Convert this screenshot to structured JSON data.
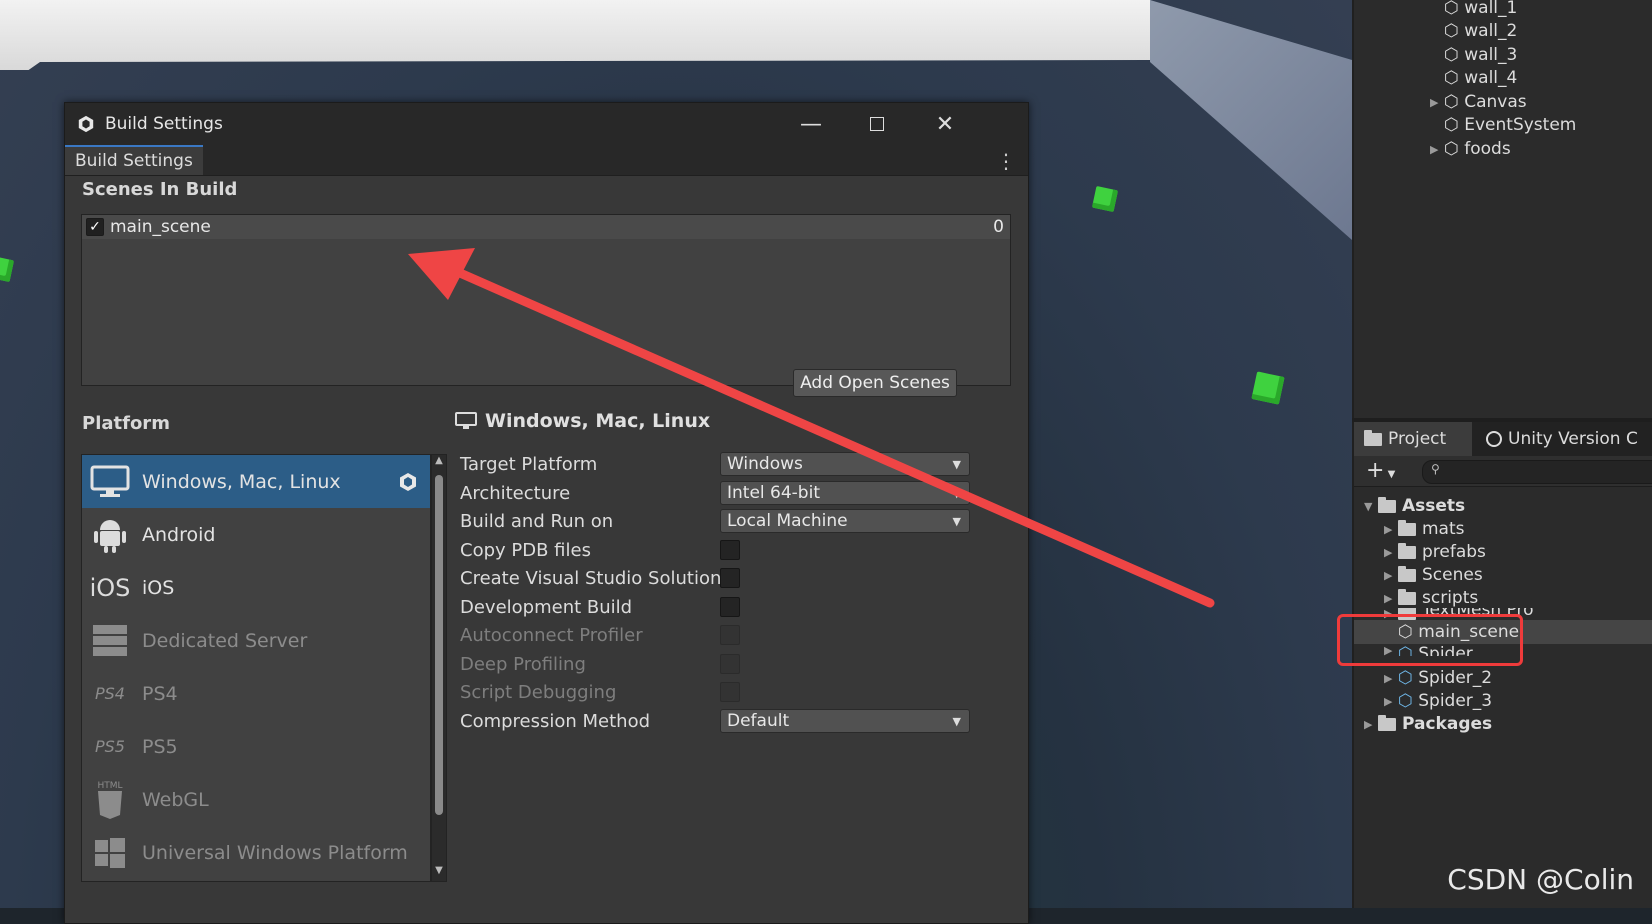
{
  "window": {
    "title": "Build Settings",
    "tab_label": "Build Settings"
  },
  "scenes": {
    "heading": "Scenes In Build",
    "items": [
      {
        "name": "main_scene",
        "index": "0",
        "checked": true
      }
    ],
    "add_button": "Add Open Scenes"
  },
  "platform": {
    "heading": "Platform",
    "items": [
      {
        "label": "Windows, Mac, Linux",
        "icon": "monitor-icon",
        "selected": true
      },
      {
        "label": "Android",
        "icon": "android-icon",
        "selected": false
      },
      {
        "label": "iOS",
        "icon": "ios-icon",
        "selected": false
      },
      {
        "label": "Dedicated Server",
        "icon": "server-icon",
        "selected": false
      },
      {
        "label": "PS4",
        "icon": "ps4-icon",
        "selected": false
      },
      {
        "label": "PS5",
        "icon": "ps5-icon",
        "selected": false
      },
      {
        "label": "WebGL",
        "icon": "html5-icon",
        "selected": false
      },
      {
        "label": "Universal Windows Platform",
        "icon": "windows-icon",
        "selected": false
      }
    ],
    "ios_glyph": "iOS",
    "ps4_glyph": "PS4",
    "ps5_glyph": "PS5",
    "html_glyph": "HTML"
  },
  "settings": {
    "heading": "Windows, Mac, Linux",
    "target_platform": {
      "label": "Target Platform",
      "value": "Windows"
    },
    "architecture": {
      "label": "Architecture",
      "value": "Intel 64-bit"
    },
    "build_run_on": {
      "label": "Build and Run on",
      "value": "Local Machine"
    },
    "copy_pdb": {
      "label": "Copy PDB files"
    },
    "create_vs": {
      "label": "Create Visual Studio Solution"
    },
    "dev_build": {
      "label": "Development Build"
    },
    "autoconnect": {
      "label": "Autoconnect Profiler"
    },
    "deep_profiling": {
      "label": "Deep Profiling"
    },
    "script_debugging": {
      "label": "Script Debugging"
    },
    "compression": {
      "label": "Compression Method",
      "value": "Default"
    }
  },
  "hierarchy": {
    "items": [
      {
        "label": "wall_1",
        "expandable": false
      },
      {
        "label": "wall_2",
        "expandable": false
      },
      {
        "label": "wall_3",
        "expandable": false
      },
      {
        "label": "wall_4",
        "expandable": false
      },
      {
        "label": "Canvas",
        "expandable": true
      },
      {
        "label": "EventSystem",
        "expandable": false
      },
      {
        "label": "foods",
        "expandable": true
      }
    ]
  },
  "project": {
    "tab_project": "Project",
    "tab_version": "Unity Version C",
    "add_label": "+",
    "assets_label": "Assets",
    "folders": [
      "mats",
      "prefabs",
      "Scenes",
      "scripts",
      "TextMesh Pro"
    ],
    "scene_file": "main_scene",
    "prefabs": [
      "Spider",
      "Spider_2",
      "Spider_3"
    ],
    "packages_label": "Packages"
  },
  "watermark": "CSDN @Colin",
  "colors": {
    "selection": "#2c5d87",
    "annotation_red": "#ef3b3b",
    "cube_green": "#3fd23f"
  }
}
